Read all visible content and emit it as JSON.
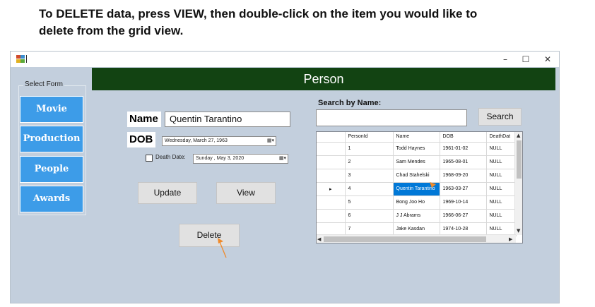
{
  "instruction": {
    "line1": "To DELETE data, press VIEW, then double-click on the item you would like to",
    "line2": "delete from the grid view."
  },
  "window": {
    "title": "",
    "controls": {
      "minimize": "–",
      "maximize": "☐",
      "close": "✕"
    }
  },
  "header": {
    "title": "Person",
    "color": "#124312"
  },
  "sidebar": {
    "group_label": "Select Form",
    "items": [
      {
        "label": "Movie"
      },
      {
        "label": "Production"
      },
      {
        "label": "People"
      },
      {
        "label": "Awards"
      }
    ],
    "button_color": "#3d9ce8"
  },
  "form": {
    "name_label": "Name",
    "name_value": "Quentin Tarantino",
    "dob_label": "DOB",
    "dob_value": "Wednesday,   March   27, 1963",
    "death_checkbox_label": "Death Date:",
    "death_checked": false,
    "death_value": "Sunday   ,    May      3, 2020",
    "update_label": "Update",
    "view_label": "View",
    "delete_label": "Delete"
  },
  "search": {
    "label": "Search by Name:",
    "value": "",
    "button_label": "Search"
  },
  "grid": {
    "columns": [
      "PersonId",
      "Name",
      "DOB",
      "DeathDat"
    ],
    "rows": [
      {
        "id": "1",
        "name": "Todd Haynes",
        "dob": "1961-01-02",
        "death": "NULL"
      },
      {
        "id": "2",
        "name": "Sam Mendes",
        "dob": "1965-08-01",
        "death": "NULL"
      },
      {
        "id": "3",
        "name": "Chad Stahelski",
        "dob": "1968-09-20",
        "death": "NULL"
      },
      {
        "id": "4",
        "name": "Quentin Tarantino",
        "dob": "1963-03-27",
        "death": "NULL"
      },
      {
        "id": "5",
        "name": "Bong Joo Ho",
        "dob": "1969-10-14",
        "death": "NULL"
      },
      {
        "id": "6",
        "name": "J J Abrams",
        "dob": "1966-06-27",
        "death": "NULL"
      },
      {
        "id": "7",
        "name": "Jake Kasdan",
        "dob": "1974-10-28",
        "death": "NULL"
      }
    ],
    "selected_row_index": 3,
    "current_row_marker": "▸"
  },
  "accent_color": "#f08a2a"
}
